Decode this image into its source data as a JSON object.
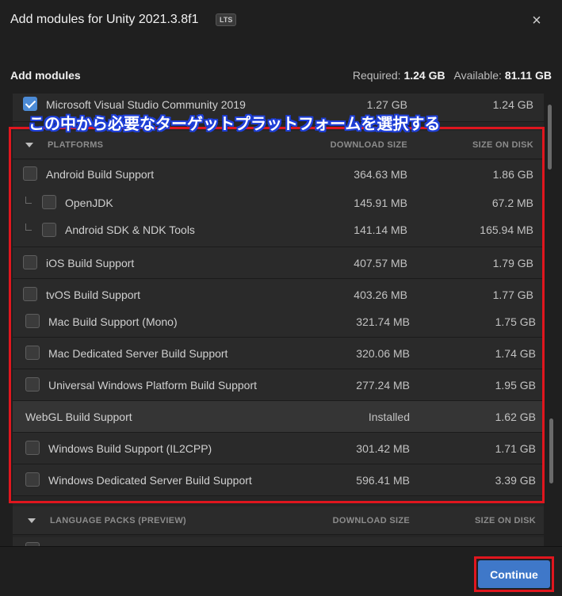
{
  "window": {
    "title": "Add modules for Unity 2021.3.8f1",
    "badge": "LTS",
    "close_icon": "×"
  },
  "header": {
    "label": "Add modules",
    "required_label": "Required:",
    "required_value": "1.24 GB",
    "available_label": "Available:",
    "available_value": "81.11 GB"
  },
  "top_row": {
    "name": "Microsoft Visual Studio Community 2019",
    "download": "1.27 GB",
    "size": "1.24 GB",
    "checked": true
  },
  "annotation": {
    "text": "この中から必要なターゲットプラットフォームを選択する"
  },
  "platforms": {
    "title": "PLATFORMS",
    "col_download": "DOWNLOAD SIZE",
    "col_size": "SIZE ON DISK",
    "items": [
      {
        "name": "Android Build Support",
        "download": "364.63 MB",
        "size": "1.86 GB"
      },
      {
        "name": "OpenJDK",
        "download": "145.91 MB",
        "size": "67.2 MB"
      },
      {
        "name": "Android SDK & NDK Tools",
        "download": "141.14 MB",
        "size": "165.94 MB"
      },
      {
        "name": "iOS Build Support",
        "download": "407.57 MB",
        "size": "1.79 GB"
      },
      {
        "name": "tvOS Build Support",
        "download": "403.26 MB",
        "size": "1.77 GB"
      },
      {
        "name": "Mac Build Support (Mono)",
        "download": "321.74 MB",
        "size": "1.75 GB"
      },
      {
        "name": "Mac Dedicated Server Build Support",
        "download": "320.06 MB",
        "size": "1.74 GB"
      },
      {
        "name": "Universal Windows Platform Build Support",
        "download": "277.24 MB",
        "size": "1.95 GB"
      },
      {
        "name": "WebGL Build Support",
        "download": "Installed",
        "size": "1.62 GB"
      },
      {
        "name": "Windows Build Support (IL2CPP)",
        "download": "301.42 MB",
        "size": "1.71 GB"
      },
      {
        "name": "Windows Dedicated Server Build Support",
        "download": "596.41 MB",
        "size": "3.39 GB"
      }
    ]
  },
  "language_packs": {
    "title": "LANGUAGE PACKS (PREVIEW)",
    "col_download": "DOWNLOAD SIZE",
    "col_size": "SIZE ON DISK"
  },
  "footer": {
    "continue_label": "Continue"
  },
  "colors": {
    "accent": "#3f78c9",
    "annotation_red": "#e0161e",
    "annotation_blue": "#1e3fd8"
  }
}
